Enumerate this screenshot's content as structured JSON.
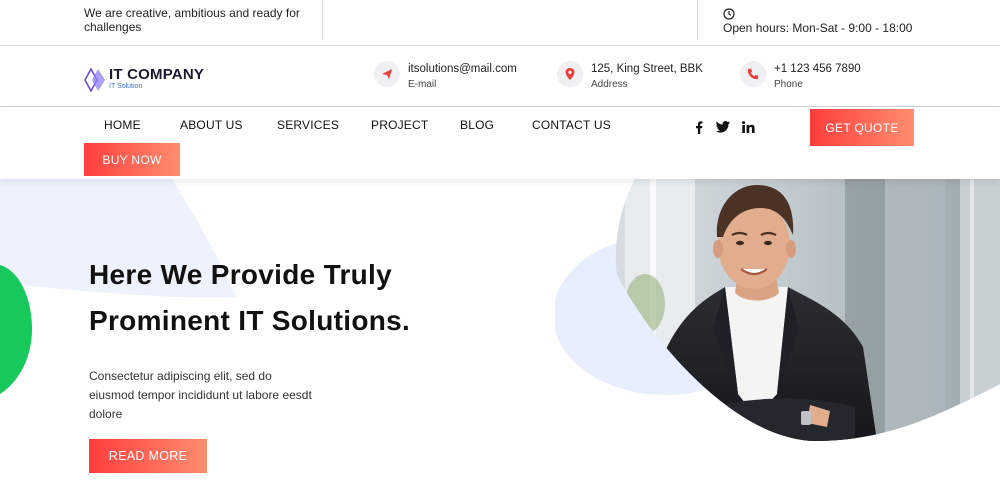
{
  "topbar": {
    "tagline": "We are creative, ambitious and ready for challenges",
    "hours": "Open hours: Mon-Sat - 9:00 - 18:00",
    "clock_icon": "clock-icon"
  },
  "brand": {
    "name": "IT COMPANY",
    "subtitle": "IT Solution",
    "logo_colors": [
      "#6d4de0",
      "#3d6fd6"
    ]
  },
  "contacts": [
    {
      "icon": "send-icon",
      "value": "itsolutions@mail.com",
      "label": "E-mail"
    },
    {
      "icon": "location-pin-icon",
      "value": "125, King Street, BBK",
      "label": "Address"
    },
    {
      "icon": "phone-icon",
      "value": "+1 123 456 7890",
      "label": "Phone"
    }
  ],
  "nav": {
    "items": [
      "HOME",
      "ABOUT US",
      "SERVICES",
      "PROJECT",
      "BLOG",
      "CONTACT US"
    ],
    "social": [
      "facebook-icon",
      "twitter-icon",
      "linkedin-icon"
    ],
    "quote_button": "GET QUOTE",
    "buy_button": "BUY NOW"
  },
  "hero": {
    "title_line1": "Here We Provide Truly",
    "title_line2": "Prominent IT Solutions.",
    "text": "Consectetur adipiscing elit, sed do eiusmod tempor incididunt ut labore eesdt dolore",
    "cta": "READ MORE"
  },
  "colors": {
    "accent_start": "#ff3d3d",
    "accent_end": "#ff8e6e",
    "icon_red": "#e8413a",
    "soft_blue": "#e8effd",
    "green": "#17c95b"
  }
}
